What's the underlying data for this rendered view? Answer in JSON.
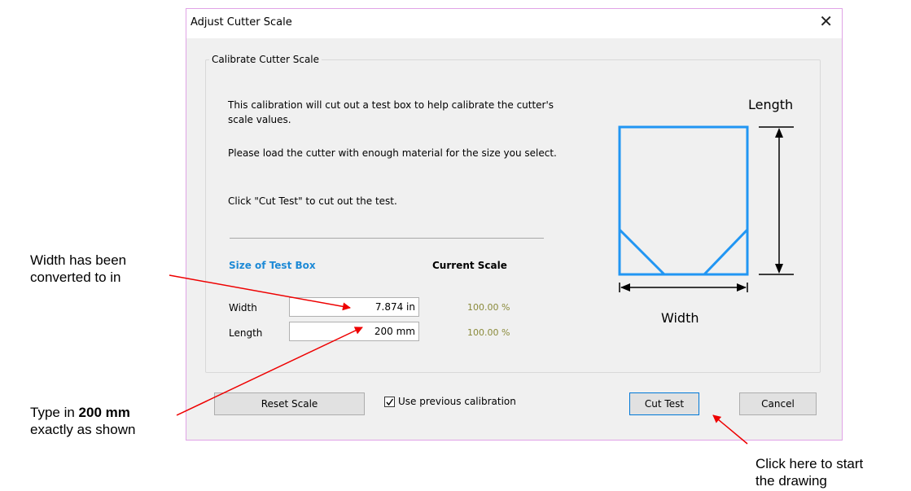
{
  "dialog": {
    "title": "Adjust Cutter Scale",
    "close_glyph": "✕",
    "group_label": "Calibrate Cutter Scale",
    "paragraphs": [
      "This calibration will cut out a test box to help calibrate the cutter's scale values.",
      "Please load the cutter with enough material for the size you select.",
      "Click \"Cut Test\" to cut out the test."
    ],
    "size_header": "Size of Test Box",
    "scale_header": "Current Scale",
    "rows": [
      {
        "label": "Width",
        "value": "7.874 in",
        "scale": "100.00 %"
      },
      {
        "label": "Length",
        "value": "200 mm",
        "scale": "100.00 %"
      }
    ],
    "diagram": {
      "length_label": "Length",
      "width_label": "Width"
    },
    "buttons": {
      "reset": "Reset Scale",
      "cut_test": "Cut Test",
      "cancel": "Cancel"
    },
    "checkbox": {
      "label": "Use previous calibration",
      "checked": true
    }
  },
  "annotations": {
    "width_note": [
      "Width has been",
      "converted to in"
    ],
    "type_note_prefix": "Type in ",
    "type_note_bold": "200 mm",
    "type_note_line2": "exactly as shown",
    "click_note": [
      "Click here to start",
      "the drawing"
    ]
  },
  "colors": {
    "accent": "#1e8ad6",
    "diagram_box": "#2196f3",
    "arrow": "#ee0000",
    "scale_text": "#8a8a3a"
  }
}
